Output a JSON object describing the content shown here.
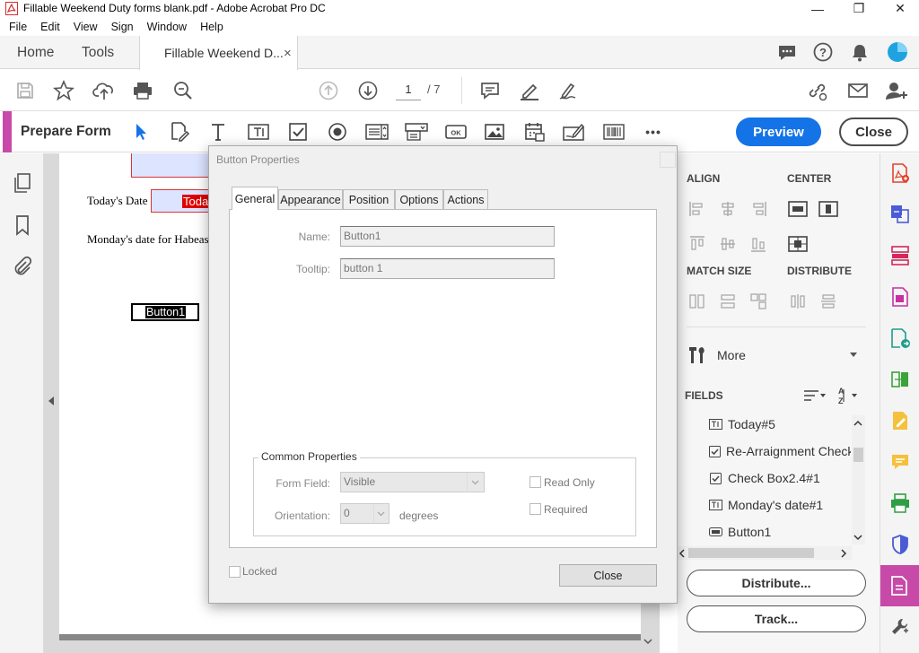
{
  "window": {
    "title": "Fillable Weekend Duty forms blank.pdf - Adobe Acrobat Pro DC",
    "minimize": "—",
    "restore": "❐",
    "close": "✕"
  },
  "menu": [
    "File",
    "Edit",
    "View",
    "Sign",
    "Window",
    "Help"
  ],
  "tabs": {
    "home": "Home",
    "tools": "Tools",
    "document": "Fillable Weekend D...",
    "document_close": "×"
  },
  "toolbar": {
    "page_current": "1",
    "page_total": "/ 7"
  },
  "prepare_form": {
    "title": "Prepare Form",
    "preview": "Preview",
    "close": "Close",
    "more": "•••",
    "ok_icon_label": "OK"
  },
  "document": {
    "todays_date_label": "Today's Date",
    "todays_date_field": "Today",
    "mondays_label": "Monday's date for Habeas",
    "button_field": "Button1"
  },
  "right_pane": {
    "align": "ALIGN",
    "center": "CENTER",
    "match_size": "MATCH SIZE",
    "distribute": "DISTRIBUTE",
    "more": "More",
    "fields_header": "FIELDS",
    "fields": [
      {
        "icon": "text-field-icon",
        "label": "Today#5"
      },
      {
        "icon": "checkbox-icon",
        "label": "Re-Arraignment Check"
      },
      {
        "icon": "checkbox-icon",
        "label": "Check Box2.4#1"
      },
      {
        "icon": "text-field-icon",
        "label": "Monday's date#1"
      },
      {
        "icon": "ok-button-icon",
        "label": "Button1"
      }
    ],
    "distribute_button": "Distribute...",
    "track_button": "Track..."
  },
  "dialog": {
    "title": "Button Properties",
    "tabs": [
      "General",
      "Appearance",
      "Position",
      "Options",
      "Actions"
    ],
    "active_tab": "General",
    "name_label": "Name:",
    "name_value": "Button1",
    "tooltip_label": "Tooltip:",
    "tooltip_value": "button 1",
    "common_properties": "Common Properties",
    "form_field_label": "Form Field:",
    "form_field_value": "Visible",
    "orientation_label": "Orientation:",
    "orientation_value": "0",
    "degrees": "degrees",
    "read_only": "Read Only",
    "required": "Required",
    "locked": "Locked",
    "close": "Close"
  },
  "colors": {
    "accent_blue": "#1473e6",
    "prepare_form_accent": "#c84aa8",
    "field_highlight": "#dde4ff",
    "required_red": "#e00000"
  }
}
